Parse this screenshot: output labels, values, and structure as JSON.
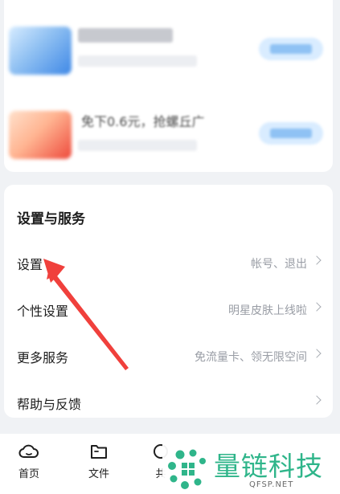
{
  "promo": {
    "items": [
      {
        "title": "",
        "thumb_color": "#3f88e6"
      },
      {
        "title": "免下0.6元，抢螺丘广",
        "thumb_color": "#ee4a3c"
      }
    ]
  },
  "settings_section": {
    "title": "设置与服务",
    "items": [
      {
        "label": "设置",
        "hint": "帐号、退出"
      },
      {
        "label": "个性设置",
        "hint": "明星皮肤上线啦"
      },
      {
        "label": "更多服务",
        "hint": "免流量卡、领无限空间"
      },
      {
        "label": "帮助与反馈",
        "hint": ""
      }
    ]
  },
  "annotation": {
    "color": "#f0403c",
    "target": "设置"
  },
  "tabbar": {
    "tabs": [
      {
        "label": "首页",
        "icon": "cloud-icon"
      },
      {
        "label": "文件",
        "icon": "folder-icon"
      },
      {
        "label": "共",
        "icon": "share-icon"
      }
    ]
  },
  "watermark": {
    "text": "量链科技",
    "url": "QFSP.NET",
    "color": "#2fb58a"
  }
}
